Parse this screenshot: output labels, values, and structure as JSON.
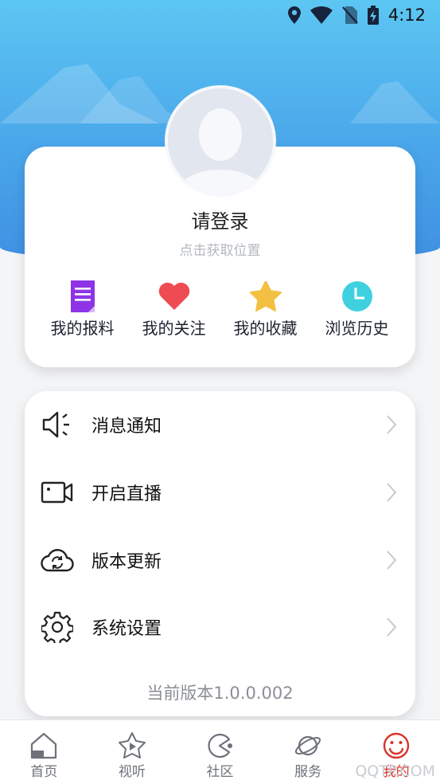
{
  "status_bar": {
    "time": "4:12"
  },
  "profile": {
    "login_prompt": "请登录",
    "location_hint": "点击获取位置"
  },
  "quick_actions": [
    {
      "label": "我的报料",
      "icon": "report-doc-icon",
      "color": "#8e34e6"
    },
    {
      "label": "我的关注",
      "icon": "heart-icon",
      "color": "#ee4b52"
    },
    {
      "label": "我的收藏",
      "icon": "star-icon",
      "color": "#f4c042"
    },
    {
      "label": "浏览历史",
      "icon": "clock-icon",
      "color": "#3fd0e0"
    }
  ],
  "menu": {
    "items": [
      {
        "label": "消息通知",
        "icon": "speaker-icon"
      },
      {
        "label": "开启直播",
        "icon": "video-camera-icon"
      },
      {
        "label": "版本更新",
        "icon": "cloud-refresh-icon"
      },
      {
        "label": "系统设置",
        "icon": "gear-icon"
      }
    ],
    "version": "当前版本1.0.0.002"
  },
  "bottom_nav": {
    "items": [
      {
        "label": "首页",
        "icon": "home-icon",
        "active": false
      },
      {
        "label": "视听",
        "icon": "play-star-icon",
        "active": false
      },
      {
        "label": "社区",
        "icon": "community-icon",
        "active": false
      },
      {
        "label": "服务",
        "icon": "planet-icon",
        "active": false
      },
      {
        "label": "我的",
        "icon": "smiley-icon",
        "active": true
      }
    ]
  },
  "watermark": "QQTP.COM",
  "colors": {
    "header_top": "#5cc6f2",
    "header_bottom": "#3f90e2",
    "active_tab": "#d9342b"
  }
}
